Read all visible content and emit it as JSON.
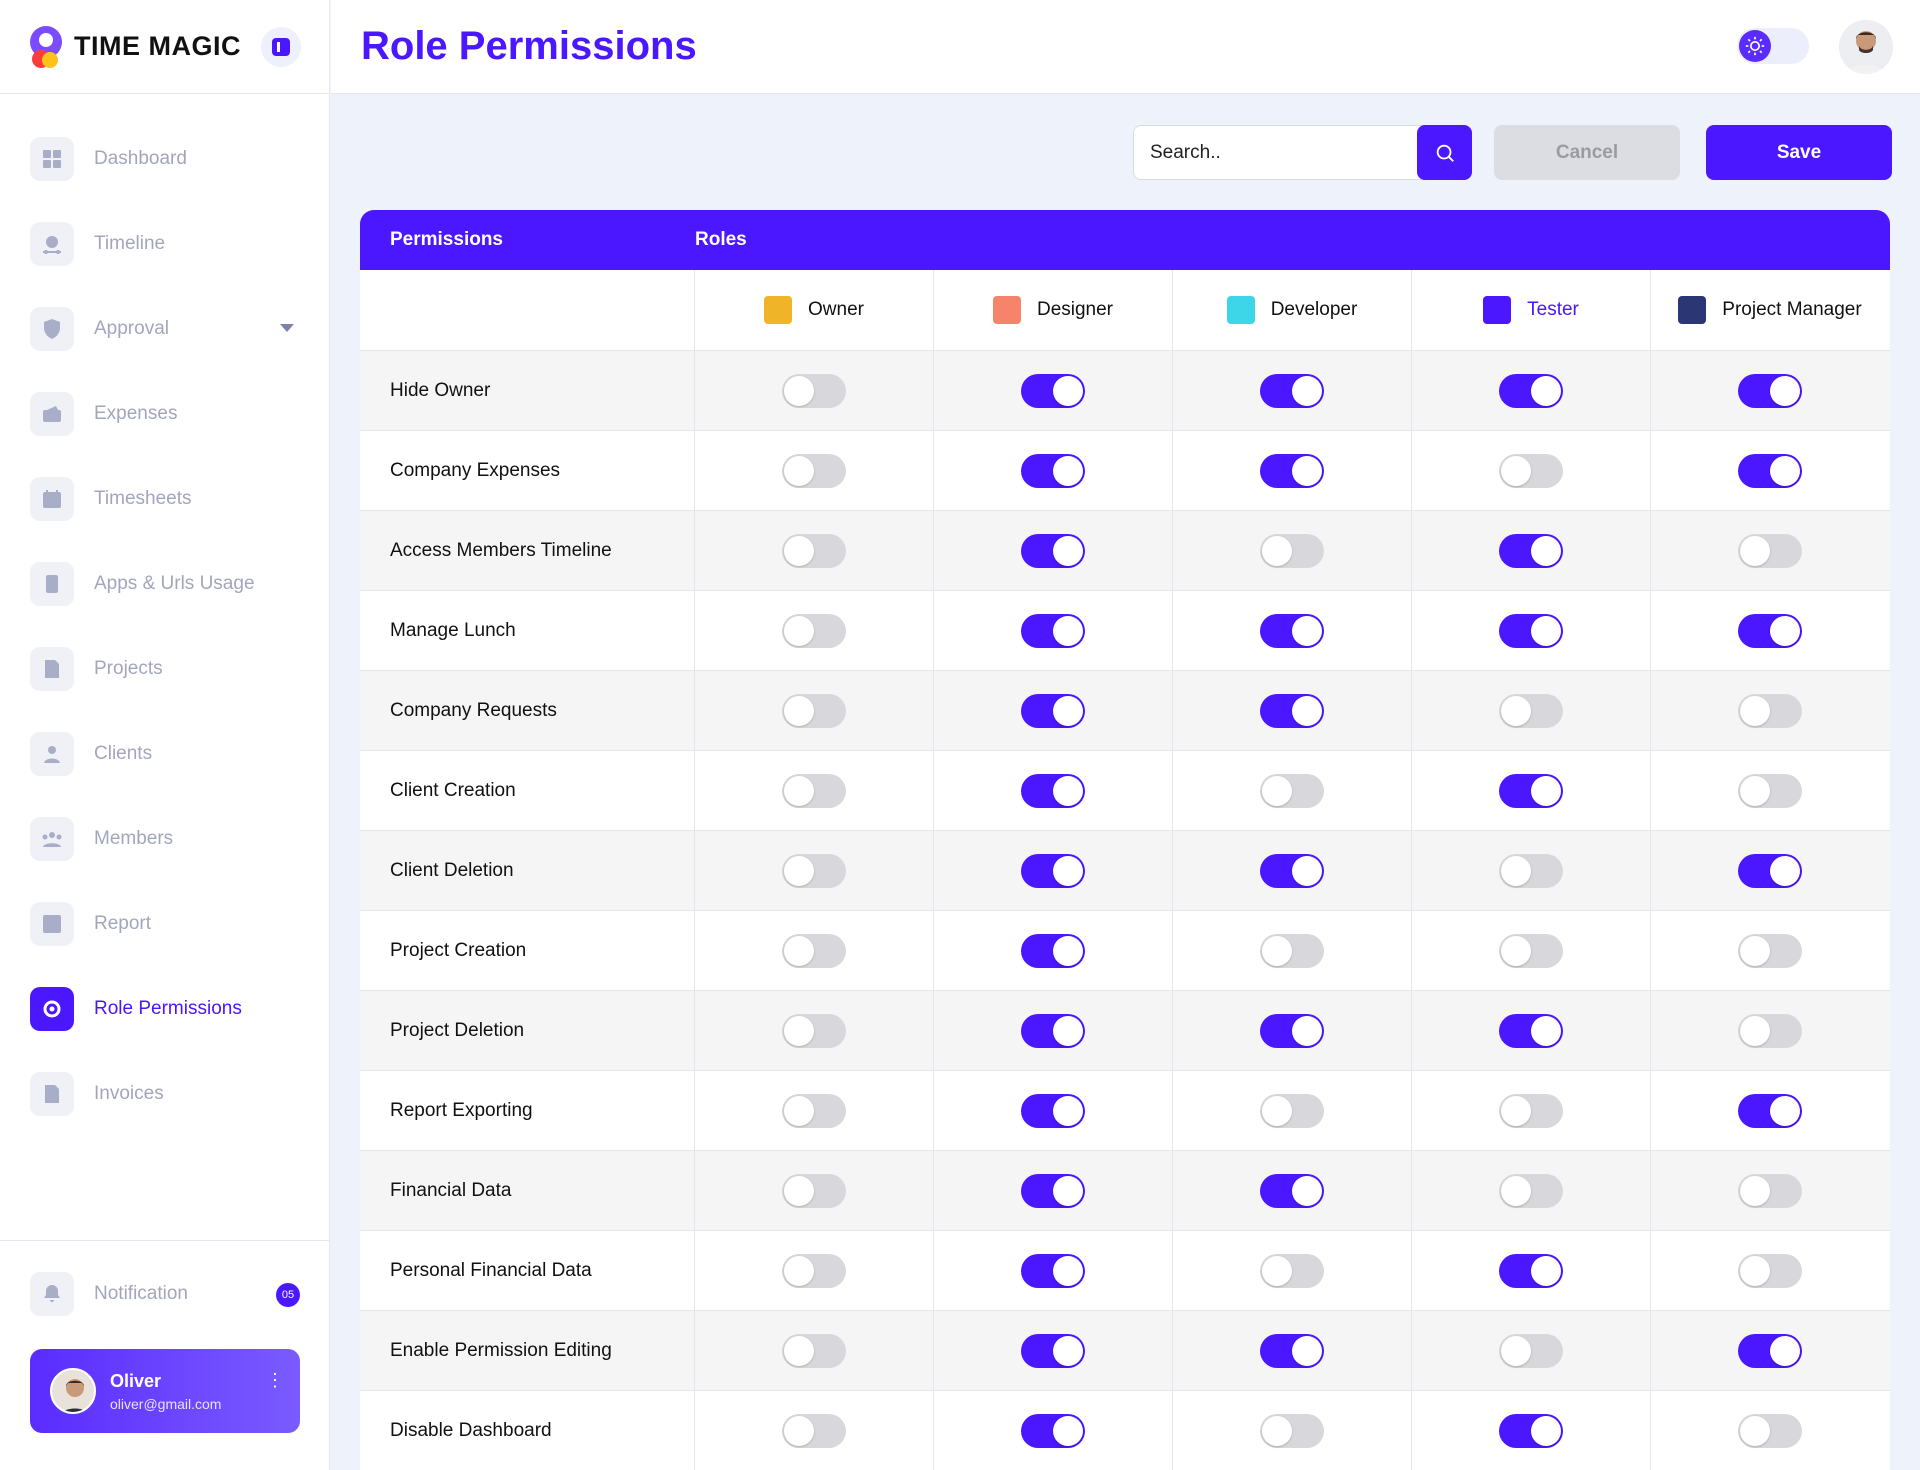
{
  "brand": {
    "name": "TIME MAGIC"
  },
  "header": {
    "title": "Role Permissions"
  },
  "sidebar": {
    "items": [
      {
        "label": "Dashboard",
        "icon": "dashboard-icon"
      },
      {
        "label": "Timeline",
        "icon": "timeline-icon"
      },
      {
        "label": "Approval",
        "icon": "shield-icon"
      },
      {
        "label": "Expenses",
        "icon": "wallet-icon"
      },
      {
        "label": "Timesheets",
        "icon": "calendar-icon"
      },
      {
        "label": "Apps & Urls Usage",
        "icon": "apps-icon"
      },
      {
        "label": "Projects",
        "icon": "projects-icon"
      },
      {
        "label": "Clients",
        "icon": "user-icon"
      },
      {
        "label": "Members",
        "icon": "members-icon"
      },
      {
        "label": "Report",
        "icon": "report-icon"
      },
      {
        "label": "Role Permissions",
        "icon": "gear-icon",
        "active": true
      },
      {
        "label": "Invoices",
        "icon": "invoice-icon"
      }
    ],
    "notification": {
      "label": "Notification",
      "count": "05"
    },
    "user": {
      "name": "Oliver",
      "email": "oliver@gmail.com"
    }
  },
  "toolbar": {
    "search_placeholder": "Search..",
    "cancel_label": "Cancel",
    "save_label": "Save"
  },
  "table": {
    "permissions_header": "Permissions",
    "roles_header": "Roles",
    "roles": [
      {
        "label": "Owner",
        "color": "#F0B429"
      },
      {
        "label": "Designer",
        "color": "#F5846A"
      },
      {
        "label": "Developer",
        "color": "#3DD6E8"
      },
      {
        "label": "Tester",
        "color": "#4A17FF"
      },
      {
        "label": "Project Manager",
        "color": "#2B3674"
      }
    ],
    "rows": [
      {
        "label": "Hide Owner",
        "values": [
          false,
          true,
          true,
          true,
          true
        ]
      },
      {
        "label": "Company Expenses",
        "values": [
          false,
          true,
          true,
          false,
          true
        ]
      },
      {
        "label": "Access Members Timeline",
        "values": [
          false,
          true,
          false,
          true,
          false
        ]
      },
      {
        "label": "Manage Lunch",
        "values": [
          false,
          true,
          true,
          true,
          true
        ]
      },
      {
        "label": "Company Requests",
        "values": [
          false,
          true,
          true,
          false,
          false
        ]
      },
      {
        "label": "Client Creation",
        "values": [
          false,
          true,
          false,
          true,
          false
        ]
      },
      {
        "label": "Client Deletion",
        "values": [
          false,
          true,
          true,
          false,
          true
        ]
      },
      {
        "label": "Project Creation",
        "values": [
          false,
          true,
          false,
          false,
          false
        ]
      },
      {
        "label": "Project Deletion",
        "values": [
          false,
          true,
          true,
          true,
          false
        ]
      },
      {
        "label": "Report Exporting",
        "values": [
          false,
          true,
          false,
          false,
          true
        ]
      },
      {
        "label": "Financial Data",
        "values": [
          false,
          true,
          true,
          false,
          false
        ]
      },
      {
        "label": "Personal Financial Data",
        "values": [
          false,
          true,
          false,
          true,
          false
        ]
      },
      {
        "label": "Enable Permission Editing",
        "values": [
          false,
          true,
          true,
          false,
          true
        ]
      },
      {
        "label": "Disable Dashboard",
        "values": [
          false,
          true,
          false,
          true,
          false
        ]
      }
    ]
  },
  "colors": {
    "accent": "#4A17FF",
    "toggle_off": "#D8D8DC"
  }
}
